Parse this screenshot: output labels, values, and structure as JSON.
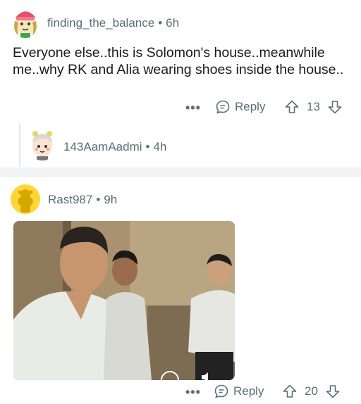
{
  "comment1": {
    "username": "finding_the_balance",
    "time": "6h",
    "body": "Everyone else..this is Solomon's house..meanwhile me..why RK and Alia wearing shoes inside the house..",
    "reply_label": "Reply",
    "votes": "13"
  },
  "comment2": {
    "username": "143AamAadmi",
    "time": "4h"
  },
  "comment3": {
    "username": "Rast987",
    "time": "9h",
    "reply_label": "Reply",
    "votes": "20"
  },
  "separator": "•",
  "more_label": "•••",
  "colors": {
    "meta": "#576f76",
    "text": "#1a1a1b",
    "divider": "#f2f3f5",
    "snoo_yellow": "#ffd635"
  },
  "icons": [
    "more-icon",
    "reply-icon",
    "upvote-icon",
    "downvote-icon",
    "play-icon"
  ]
}
